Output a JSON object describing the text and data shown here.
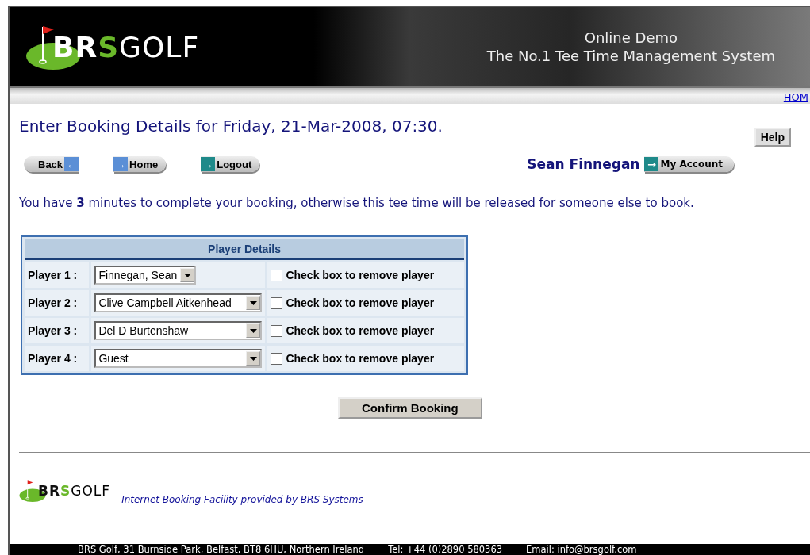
{
  "header": {
    "logo": {
      "parts": [
        "BR",
        "S",
        "GOLF"
      ]
    },
    "tagline": [
      "Online Demo",
      "The No.1 Tee Time Management System"
    ],
    "nav_link": "HOM"
  },
  "title": "Enter Booking Details for Friday, 21-Mar-2008, 07:30.",
  "help_button": "Help",
  "nav_buttons": [
    {
      "label": "Back",
      "arrow": "←",
      "kind": "back"
    },
    {
      "label": "Home",
      "arrow": "→",
      "kind": "home"
    },
    {
      "label": "Logout",
      "arrow": "→",
      "kind": "logout"
    }
  ],
  "user": {
    "name": "Sean Finnegan",
    "account_button": "My Account",
    "arrow": "→"
  },
  "message": "You have **3** minutes to complete your booking, otherwise this tee time will be released for someone else to book.",
  "player_table": {
    "heading": "Player Details",
    "rows": [
      {
        "label": "Player 1 :",
        "value": "Finnegan, Sean",
        "wide": false,
        "remove_label": "Check box to remove player",
        "checked": false
      },
      {
        "label": "Player 2 :",
        "value": "Clive Campbell Aitkenhead",
        "wide": true,
        "remove_label": "Check box to remove player",
        "checked": false
      },
      {
        "label": "Player 3 :",
        "value": "Del D Burtenshaw",
        "wide": true,
        "remove_label": "Check box to remove player",
        "checked": false
      },
      {
        "label": "Player 4 :",
        "value": "Guest",
        "wide": true,
        "remove_label": "Check box to remove player",
        "checked": false
      }
    ]
  },
  "confirm_button": "Confirm Booking",
  "footer": {
    "logo": {
      "parts": [
        "BR",
        "S",
        "GOLF"
      ]
    },
    "credit": "Internet Booking Facility provided by BRS Systems",
    "address": "BRS Golf, 31 Burnside Park, Belfast, BT8 6HU, Northern Ireland",
    "phone": "Tel: +44 (0)2890 580363",
    "email": "Email: info@brsgolf.com"
  }
}
